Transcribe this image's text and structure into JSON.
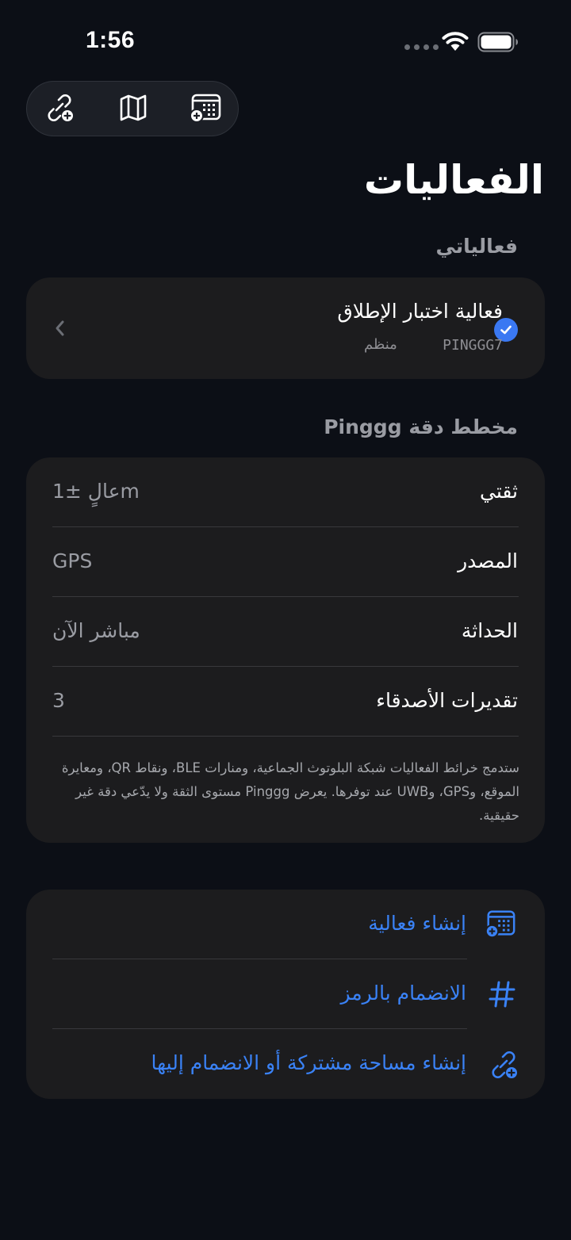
{
  "status_bar": {
    "time": "1:56"
  },
  "toolbar": {
    "items": [
      {
        "icon": "link-add-icon"
      },
      {
        "icon": "map-icon"
      },
      {
        "icon": "calendar-add-icon"
      }
    ]
  },
  "header": {
    "title": "الفعاليات"
  },
  "my_events": {
    "section_label": "فعالياتي",
    "event": {
      "name": "فعالية اختبار الإطلاق",
      "code": "PINGGG7",
      "role": "منظم",
      "selected": true
    }
  },
  "accuracy": {
    "section_label": "مخطط دقة Pinggg",
    "rows": [
      {
        "label": "ثقتي",
        "value": "عالٍ ±1m"
      },
      {
        "label": "المصدر",
        "value": "GPS"
      },
      {
        "label": "الحداثة",
        "value": "مباشر الآن"
      },
      {
        "label": "تقديرات الأصدقاء",
        "value": "3"
      }
    ],
    "note": "ستدمج خرائط الفعاليات شبكة البلوتوث الجماعية، ومنارات BLE، ونقاط QR، ومعايرة الموقع، وGPS، وUWB عند توفرها. يعرض Pinggg مستوى الثقة ولا يدّعي دقة غير حقيقية."
  },
  "actions": [
    {
      "label": "إنشاء فعالية",
      "icon": "calendar-add-icon"
    },
    {
      "label": "الانضمام بالرمز",
      "icon": "hashtag-icon"
    },
    {
      "label": "إنشاء مساحة مشتركة أو الانضمام إليها",
      "icon": "link-add-icon"
    }
  ],
  "colors": {
    "background": "#0c0f16",
    "card": "#1c1c1e",
    "accent": "#3a82f6",
    "secondary_text": "#9a9ca3"
  }
}
